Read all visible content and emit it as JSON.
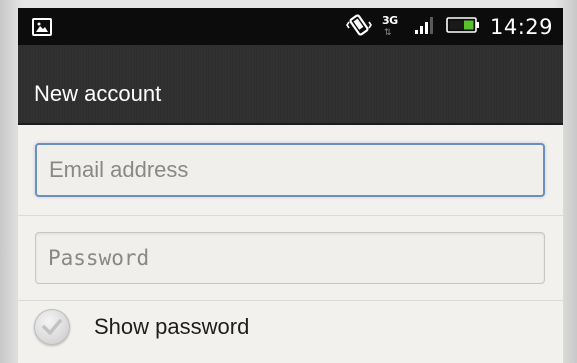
{
  "status_bar": {
    "notification_icon": "image-icon",
    "vibrate_icon": "vibrate-icon",
    "network_type": "3G",
    "data_arrows": "⇅",
    "signal_icon": "signal-bars-icon",
    "battery_icon": "battery-icon",
    "time": "14:29"
  },
  "action_bar": {
    "title": "New account"
  },
  "form": {
    "email": {
      "value": "",
      "placeholder": "Email address"
    },
    "password": {
      "value": "",
      "placeholder": "Password"
    },
    "show_password": {
      "label": "Show password",
      "checked": false
    }
  },
  "colors": {
    "status_bar_bg": "#0c0c0c",
    "action_bar_bg": "#2f2f2f",
    "content_bg": "#f3f1ee",
    "focus_border": "#6b8fbe",
    "battery_green": "#59c12d"
  }
}
